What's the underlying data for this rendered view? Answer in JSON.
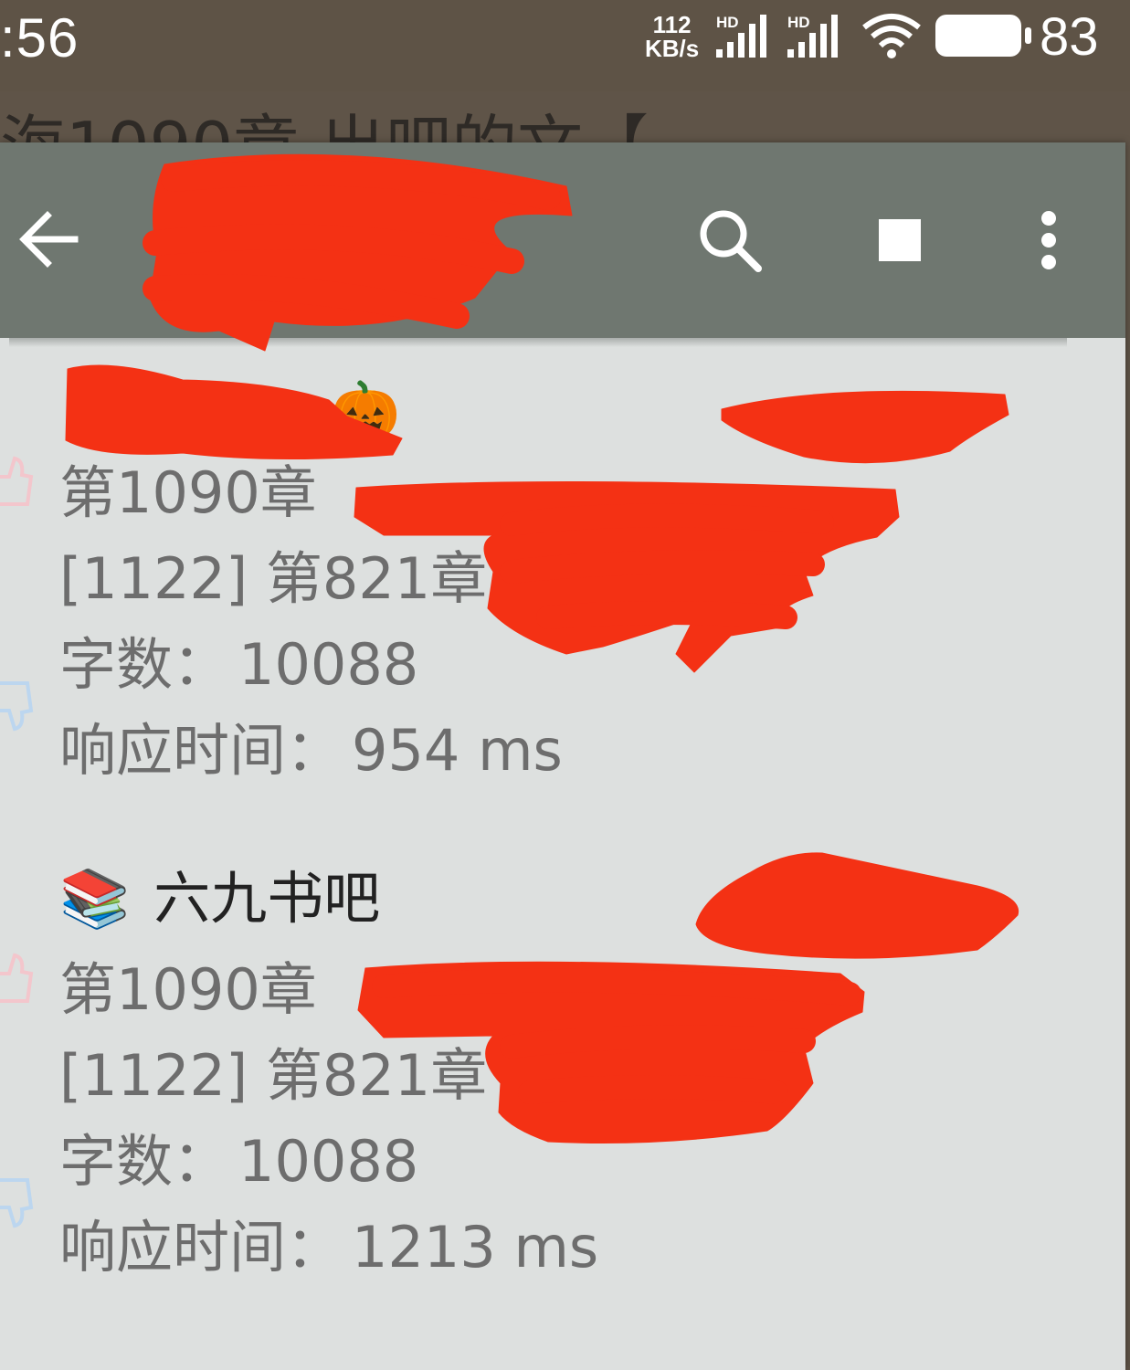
{
  "status_bar": {
    "time": ":56",
    "net_speed_value": "112",
    "net_speed_unit": "KB/s",
    "signal_1_label": "HD",
    "signal_2_label": "HD",
    "battery_level": "83",
    "icons": [
      "signal-icon",
      "signal-icon",
      "wifi-icon",
      "battery-icon"
    ]
  },
  "behind_title": "海1090章 出吧的文【",
  "toolbar": {
    "title": "",
    "icons": [
      "back-arrow-icon",
      "search-icon",
      "stop-icon",
      "more-vert-icon"
    ],
    "background": "#6f7770"
  },
  "sources": [
    {
      "emoji": "🎃",
      "name": "",
      "latest_chapter": "第1090章",
      "current_chapter": "[1122] 第821章",
      "word_count_label": "字数：",
      "word_count": "10088",
      "response_label": "响应时间：",
      "response_time": "954 ms"
    },
    {
      "emoji": "📚",
      "name": "六九书吧",
      "latest_chapter": "第1090章",
      "current_chapter": "[1122] 第821章",
      "word_count_label": "字数：",
      "word_count": "10088",
      "response_label": "响应时间：",
      "response_time": "1213 ms"
    }
  ],
  "colors": {
    "dialog_background": "#dde0df",
    "redaction": "#f43114",
    "primary_text": "#222222",
    "secondary_text": "#6d6d6d"
  }
}
